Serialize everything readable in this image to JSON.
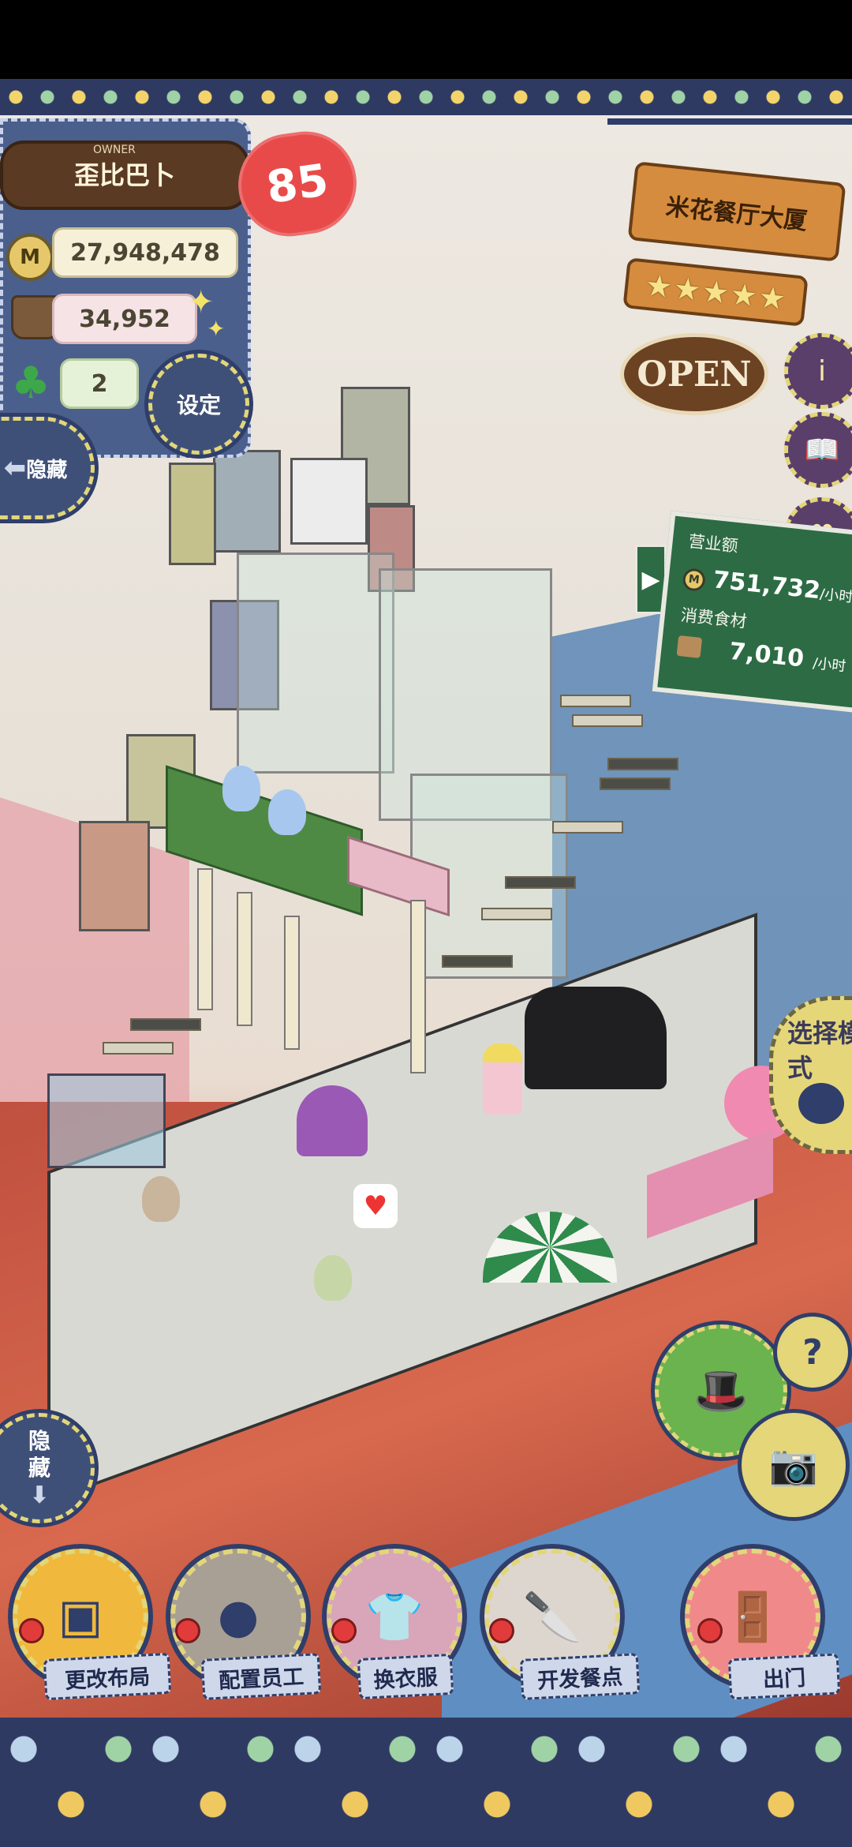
{
  "owner": {
    "tag": "OWNER",
    "name": "歪比巴卜",
    "level": "85",
    "coins": "27,948,478",
    "food": "34,952",
    "clovers": "2"
  },
  "buttons": {
    "settings": "设定",
    "hide_top": "隐藏",
    "hide_bottom": "隐藏",
    "mode": "选择模式",
    "help": "?"
  },
  "sign": {
    "name": "米花餐厅大厦",
    "stars": 5,
    "status": "OPEN"
  },
  "revenue": {
    "sales_label": "营业额",
    "sales_value": "751,732",
    "sales_unit": "/小时",
    "food_label": "消费食材",
    "food_value": "7,010",
    "food_unit": "/小时"
  },
  "bottom_menu": [
    {
      "label": "更改布局",
      "icon": "table-icon",
      "bg": "#f0b93d"
    },
    {
      "label": "配置员工",
      "icon": "bear-icon",
      "bg": "#a8a094"
    },
    {
      "label": "换衣服",
      "icon": "shirt-icon",
      "bg": "#d8a6b8"
    },
    {
      "label": "开发餐点",
      "icon": "knife-icon",
      "bg": "#ddd6cf"
    },
    {
      "label": "出门",
      "icon": "door-icon",
      "bg": "#f08a8a"
    }
  ],
  "side_icons": [
    "info-icon",
    "book-icon",
    "heart-speech-icon"
  ],
  "colors": {
    "navy": "#2f3e6a",
    "sign_wood": "#d68c3e",
    "board_green": "#2d6b44",
    "heart_red": "#e84a4a"
  }
}
